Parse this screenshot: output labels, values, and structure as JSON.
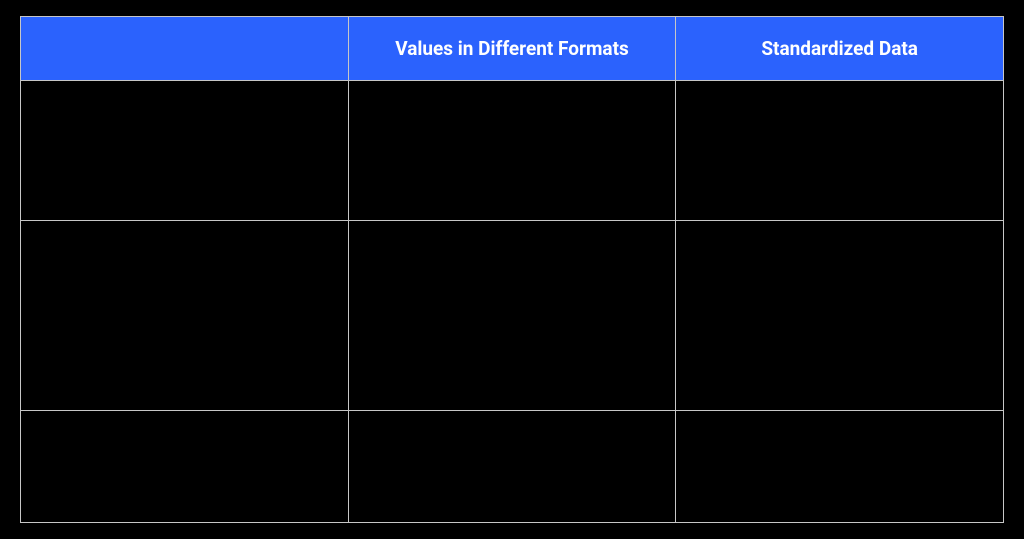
{
  "chart_data": {
    "type": "table",
    "title": "",
    "columns": [
      "",
      "Values in Different Formats",
      "Standardized Data"
    ],
    "rows": [
      [
        "",
        "",
        ""
      ],
      [
        "",
        "",
        ""
      ],
      [
        "",
        "",
        ""
      ]
    ]
  },
  "headers": {
    "col0": "",
    "col1": "Values in Different Formats",
    "col2": "Standardized Data"
  },
  "body": {
    "r0": {
      "c0": "",
      "c1": "",
      "c2": ""
    },
    "r1": {
      "c0": "",
      "c1": "",
      "c2": ""
    },
    "r2": {
      "c0": "",
      "c1": "",
      "c2": ""
    }
  }
}
